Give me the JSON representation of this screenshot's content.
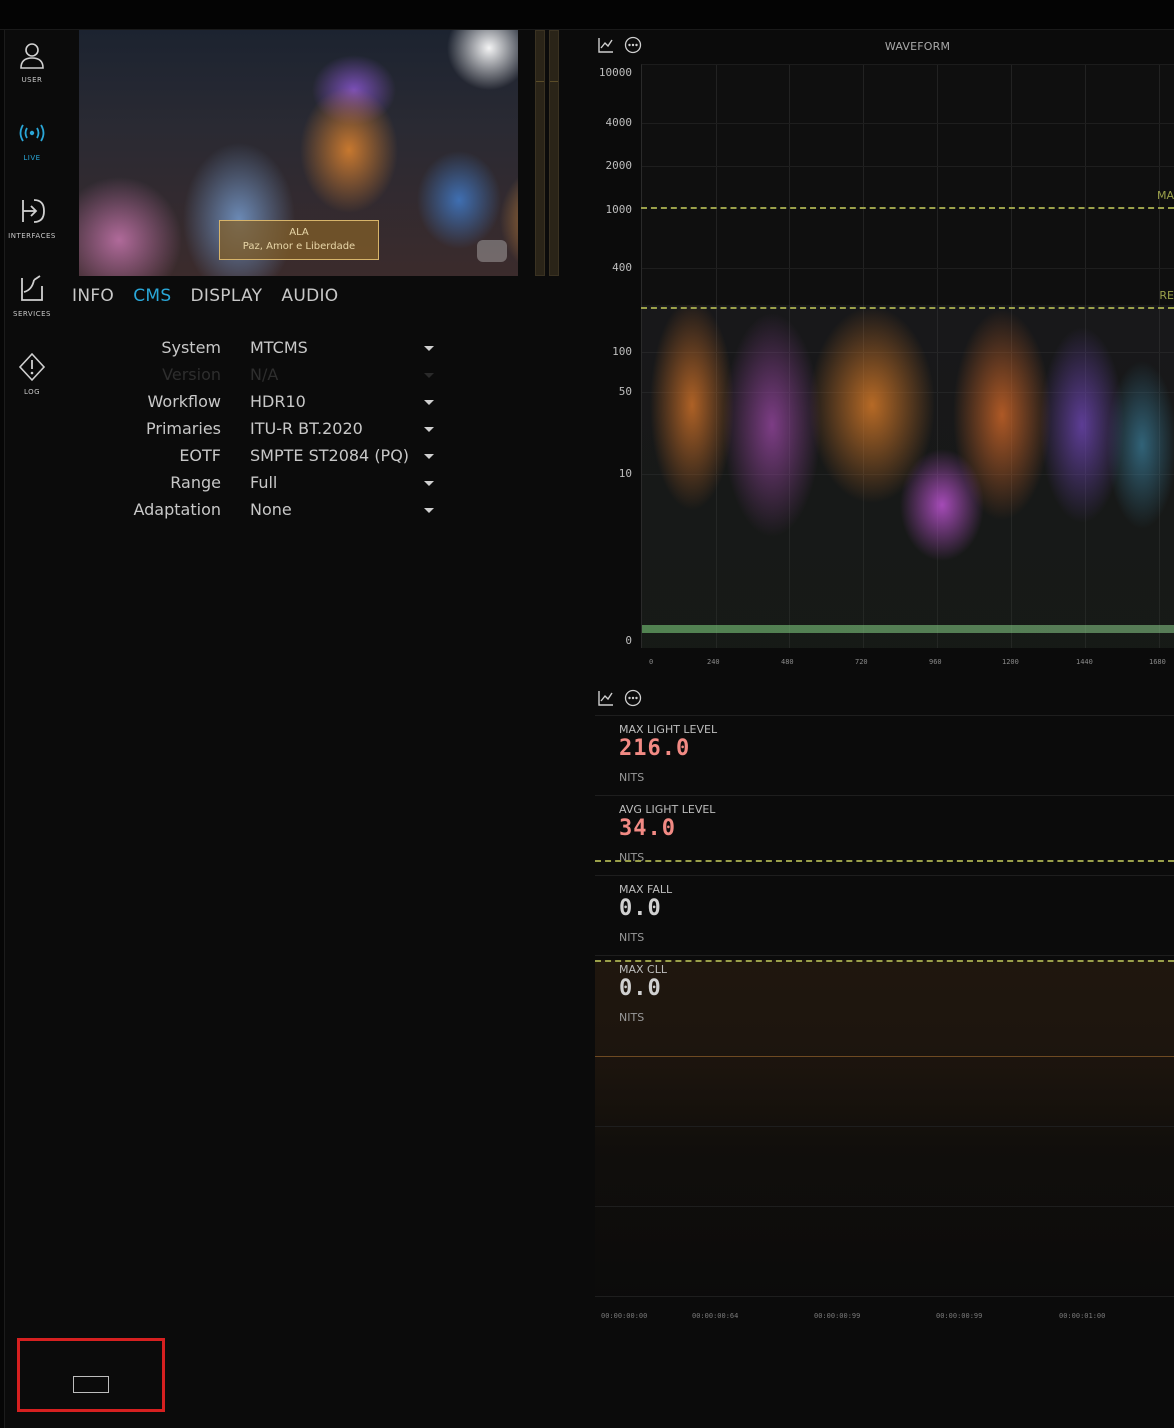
{
  "sidebar": {
    "items": [
      {
        "label": "USER",
        "icon": "user-icon"
      },
      {
        "label": "LIVE",
        "icon": "broadcast-icon",
        "active": true
      },
      {
        "label": "INTERFACES",
        "icon": "interfaces-icon"
      },
      {
        "label": "SERVICES",
        "icon": "services-icon"
      },
      {
        "label": "LOG",
        "icon": "warning-icon"
      }
    ]
  },
  "video": {
    "caption_line1": "ALA",
    "caption_line2": "Paz, Amor e Liberdade"
  },
  "tabs": [
    "INFO",
    "CMS",
    "DISPLAY",
    "AUDIO"
  ],
  "active_tab": "CMS",
  "cms": {
    "rows": [
      {
        "label": "System",
        "value": "MTCMS"
      },
      {
        "label": "Version",
        "value": "N/A",
        "disabled": true
      },
      {
        "label": "Workflow",
        "value": "HDR10"
      },
      {
        "label": "Primaries",
        "value": "ITU-R BT.2020"
      },
      {
        "label": "EOTF",
        "value": "SMPTE ST2084 (PQ)"
      },
      {
        "label": "Range",
        "value": "Full"
      },
      {
        "label": "Adaptation",
        "value": "None"
      }
    ]
  },
  "waveform": {
    "title": "WAVEFORM",
    "y_ticks": [
      "10000",
      "4000",
      "2000",
      "1000",
      "400",
      "100",
      "50",
      "10",
      "0"
    ],
    "x_ticks": [
      "0",
      "240",
      "480",
      "720",
      "960",
      "1200",
      "1440",
      "1680"
    ],
    "ref_labels": [
      "MA",
      "RE"
    ]
  },
  "stats": [
    {
      "label": "MAX LIGHT LEVEL",
      "value": "216.0",
      "unit": "NITS"
    },
    {
      "label": "AVG LIGHT LEVEL",
      "value": "34.0",
      "unit": "NITS"
    },
    {
      "label": "MAX FALL",
      "value": "0.0",
      "unit": "NITS"
    },
    {
      "label": "MAX CLL",
      "value": "0.0",
      "unit": "NITS"
    }
  ],
  "timeline": {
    "ticks": [
      "00:00:00:00",
      "00:00:00:64",
      "00:00:00:99",
      "00:00:00:99",
      "00:00:01:00"
    ]
  },
  "colors": {
    "accent": "#2aa7d8",
    "hot_value": "#f28a84",
    "reference_line": "#9aa04a",
    "highlight_box": "#d62020"
  }
}
